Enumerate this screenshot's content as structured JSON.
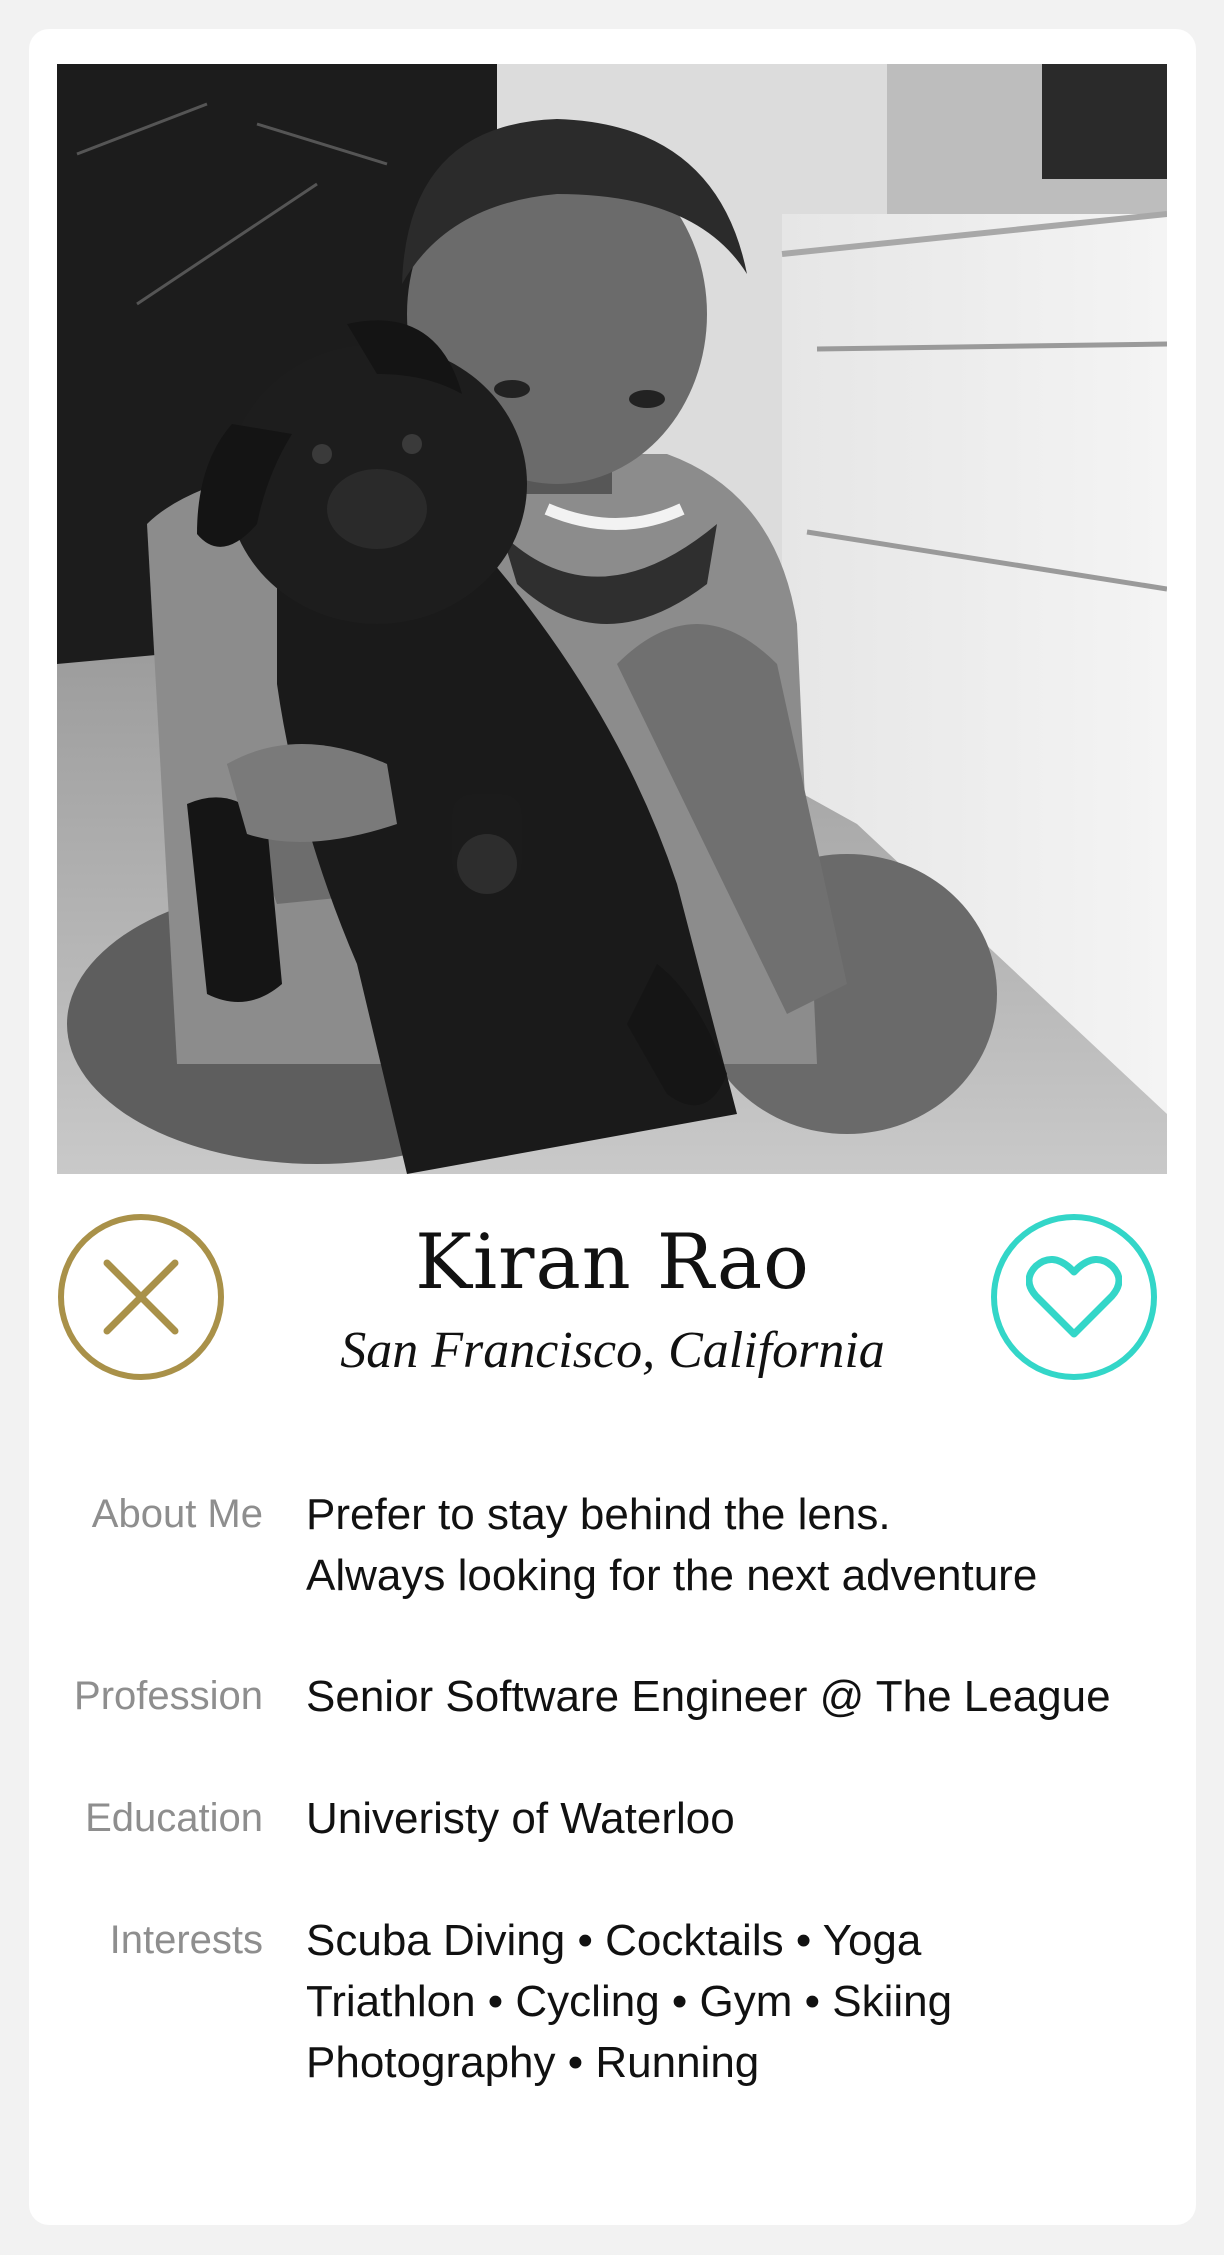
{
  "profile": {
    "name": "Kiran Rao",
    "location": "San Francisco, California",
    "photo_icon": "profile-photo"
  },
  "actions": {
    "pass_icon": "close-icon",
    "like_icon": "heart-icon",
    "pass_color": "#a99149",
    "like_color": "#33d6c8"
  },
  "details": {
    "about": {
      "label": "About Me",
      "lines": [
        "Prefer to stay behind the lens.",
        "Always looking for the next adventure"
      ]
    },
    "profession": {
      "label": "Profession",
      "value": "Senior Software Engineer @ The League"
    },
    "education": {
      "label": "Education",
      "value": "Univeristy of Waterloo"
    },
    "interests": {
      "label": "Interests",
      "lines": [
        "Scuba Diving • Cocktails • Yoga",
        "Triathlon • Cycling • Gym • Skiing",
        "Photography • Running"
      ]
    }
  }
}
